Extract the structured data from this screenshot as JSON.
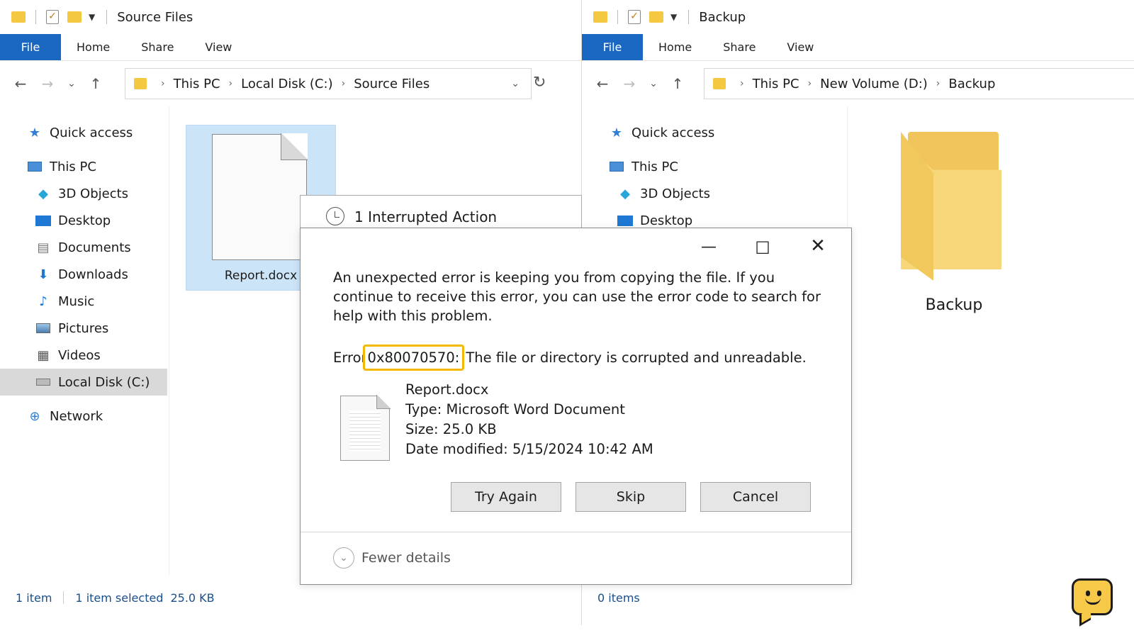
{
  "left_window": {
    "title": "Source Files",
    "ribbon": {
      "file": "File",
      "home": "Home",
      "share": "Share",
      "view": "View"
    },
    "breadcrumb": [
      "This PC",
      "Local Disk (C:)",
      "Source Files"
    ],
    "sidebar": {
      "quick_access": "Quick access",
      "this_pc": "This PC",
      "items": [
        "3D Objects",
        "Desktop",
        "Documents",
        "Downloads",
        "Music",
        "Pictures",
        "Videos",
        "Local Disk (C:)"
      ],
      "network": "Network"
    },
    "file_name": "Report.docx",
    "status": {
      "count": "1 item",
      "selected": "1 item selected",
      "size": "25.0 KB"
    }
  },
  "right_window": {
    "title": "Backup",
    "ribbon": {
      "file": "File",
      "home": "Home",
      "share": "Share",
      "view": "View"
    },
    "breadcrumb": [
      "This PC",
      "New Volume (D:)",
      "Backup"
    ],
    "sidebar": {
      "quick_access": "Quick access",
      "this_pc": "This PC",
      "items": [
        "3D Objects",
        "Desktop"
      ]
    },
    "folder_name": "Backup",
    "status": {
      "count": "0 items"
    }
  },
  "interrupt": {
    "title": "1 Interrupted Action"
  },
  "dialog": {
    "message": "An unexpected error is keeping you from copying the file. If you continue to receive this error, you can use the error code to search for help with this problem.",
    "error_prefix": "Error",
    "error_code": "0x80070570:",
    "error_text": "The file or directory is corrupted and unreadable.",
    "file_name": "Report.docx",
    "file_type": "Type: Microsoft Word Document",
    "file_size": "Size: 25.0 KB",
    "file_date": "Date modified: 5/15/2024 10:42 AM",
    "buttons": {
      "try_again": "Try Again",
      "skip": "Skip",
      "cancel": "Cancel"
    },
    "fewer_details": "Fewer details"
  },
  "colors": {
    "accent": "#1a67c2",
    "highlight": "#f5b800",
    "selection": "#cce4f7"
  }
}
